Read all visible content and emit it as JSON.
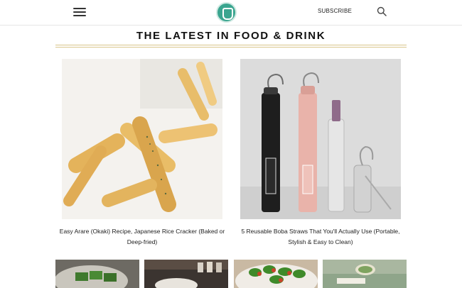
{
  "header": {
    "subscribe_label": "SUBSCRIBE",
    "icons": {
      "menu": "hamburger-menu-icon",
      "logo": "site-logo",
      "search": "search-icon"
    }
  },
  "section": {
    "title": "THE LATEST IN FOOD & DRINK"
  },
  "posts": [
    {
      "title": "Easy Arare (Okaki) Recipe, Japanese Rice Cracker (Baked or Deep-fried)"
    },
    {
      "title": "5 Reusable Boba Straws That You'll Actually Use (Portable, Stylish & Easy to Clean)"
    }
  ],
  "colors": {
    "accent_rule": "#d9c58a",
    "logo": "#3aa58f"
  }
}
